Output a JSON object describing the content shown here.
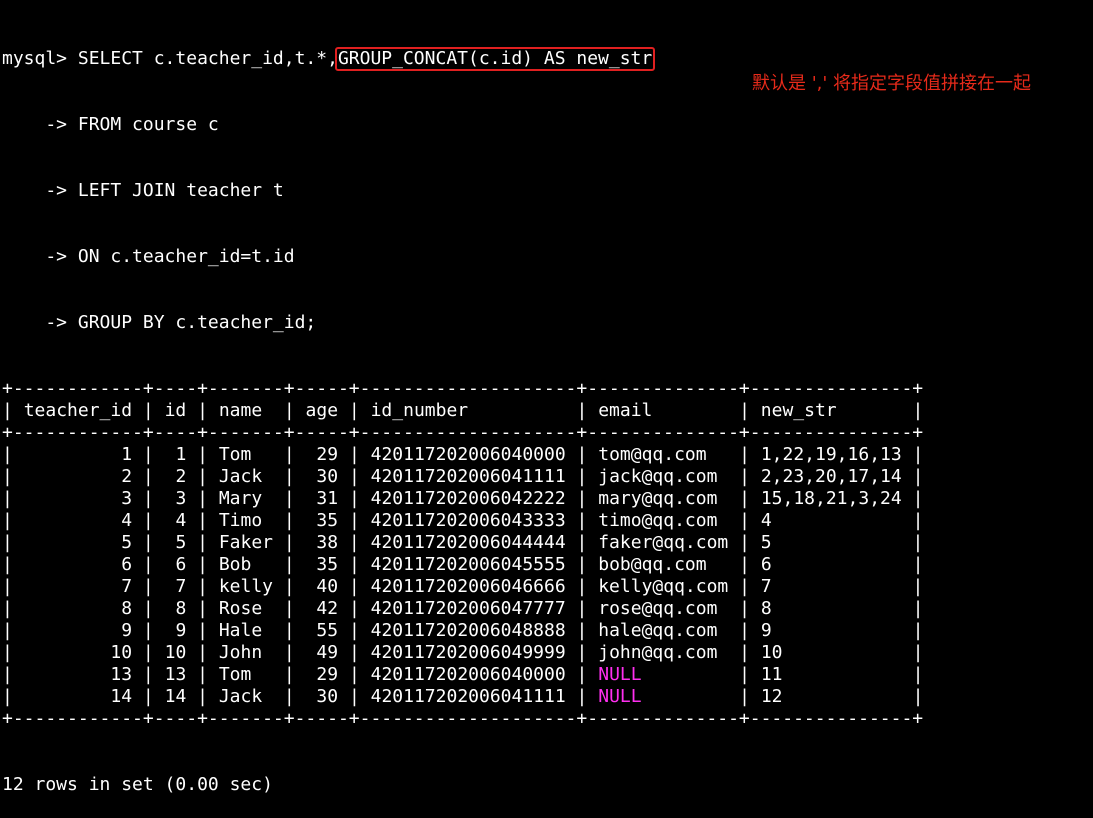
{
  "prompt": "mysql> ",
  "query": {
    "line1_prefix": "SELECT c.teacher_id,t.*,",
    "line1_highlight": "GROUP_CONCAT(c.id) AS new_str",
    "continuation": "    -> ",
    "line2": "FROM course c",
    "line3": "LEFT JOIN teacher t",
    "line4": "ON c.teacher_id=t.id",
    "line5": "GROUP BY c.teacher_id;"
  },
  "annotation_text": "默认是 ',' 将指定字段值拼接在一起",
  "table": {
    "columns": [
      "teacher_id",
      "id",
      "name",
      "age",
      "id_number",
      "email",
      "new_str"
    ],
    "rows": [
      [
        "1",
        "1",
        "Tom",
        "29",
        "420117202006040000",
        "tom@qq.com",
        "1,22,19,16,13"
      ],
      [
        "2",
        "2",
        "Jack",
        "30",
        "420117202006041111",
        "jack@qq.com",
        "2,23,20,17,14"
      ],
      [
        "3",
        "3",
        "Mary",
        "31",
        "420117202006042222",
        "mary@qq.com",
        "15,18,21,3,24"
      ],
      [
        "4",
        "4",
        "Timo",
        "35",
        "420117202006043333",
        "timo@qq.com",
        "4"
      ],
      [
        "5",
        "5",
        "Faker",
        "38",
        "420117202006044444",
        "faker@qq.com",
        "5"
      ],
      [
        "6",
        "6",
        "Bob",
        "35",
        "420117202006045555",
        "bob@qq.com",
        "6"
      ],
      [
        "7",
        "7",
        "kelly",
        "40",
        "420117202006046666",
        "kelly@qq.com",
        "7"
      ],
      [
        "8",
        "8",
        "Rose",
        "42",
        "420117202006047777",
        "rose@qq.com",
        "8"
      ],
      [
        "9",
        "9",
        "Hale",
        "55",
        "420117202006048888",
        "hale@qq.com",
        "9"
      ],
      [
        "10",
        "10",
        "John",
        "49",
        "420117202006049999",
        "john@qq.com",
        "10"
      ],
      [
        "13",
        "13",
        "Tom",
        "29",
        "420117202006040000",
        "NULL",
        "11"
      ],
      [
        "14",
        "14",
        "Jack",
        "30",
        "420117202006041111",
        "NULL",
        "12"
      ]
    ]
  },
  "result_summary": "12 rows in set (0.00 sec)",
  "colors": {
    "background": "#000000",
    "text": "#ffffff",
    "highlight_border": "#e02020",
    "annotation": "#e62a1a",
    "null_value": "#ff2ff0"
  }
}
